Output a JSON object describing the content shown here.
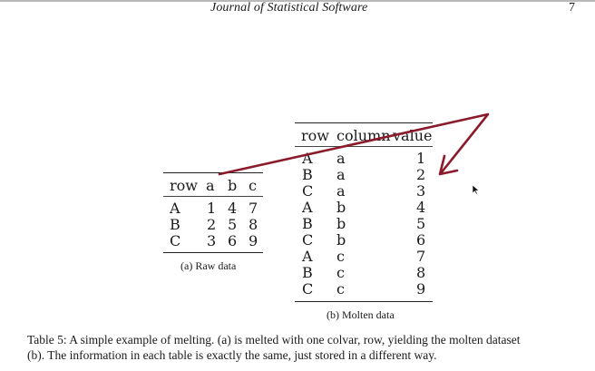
{
  "header": {
    "journal": "Journal of Statistical Software",
    "page_number": "7"
  },
  "raw_table": {
    "columns": [
      "row",
      "a",
      "b",
      "c"
    ],
    "rows": [
      [
        "A",
        "1",
        "4",
        "7"
      ],
      [
        "B",
        "2",
        "5",
        "8"
      ],
      [
        "C",
        "3",
        "6",
        "9"
      ]
    ],
    "caption": "(a) Raw data"
  },
  "molten_table": {
    "columns": [
      "row",
      "column",
      "value"
    ],
    "rows": [
      [
        "A",
        "a",
        "1"
      ],
      [
        "B",
        "a",
        "2"
      ],
      [
        "C",
        "a",
        "3"
      ],
      [
        "A",
        "b",
        "4"
      ],
      [
        "B",
        "b",
        "5"
      ],
      [
        "C",
        "b",
        "6"
      ],
      [
        "A",
        "c",
        "7"
      ],
      [
        "B",
        "c",
        "8"
      ],
      [
        "C",
        "c",
        "9"
      ]
    ],
    "caption": "(b) Molten data"
  },
  "table_caption": {
    "line1": "Table 5: A simple example of melting. (a) is melted with one colvar, row, yielding the molten dataset",
    "line2": "(b). The information in each table is exactly the same, just stored in a different way."
  },
  "annotation": {
    "color": "#8b1a2b",
    "icon": "pen-arrow-annotation"
  },
  "cursor": {
    "icon": "mouse-pointer-icon"
  }
}
